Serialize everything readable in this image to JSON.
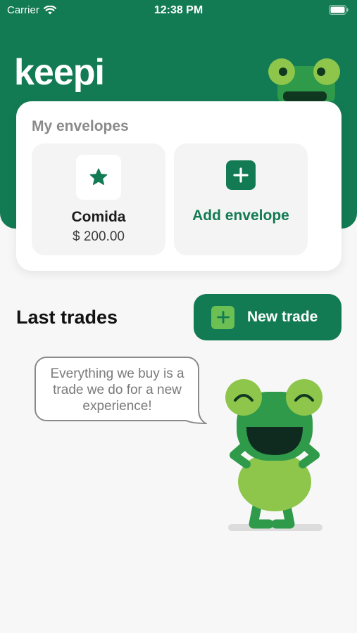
{
  "status_bar": {
    "carrier": "Carrier",
    "time": "12:38 PM"
  },
  "app": {
    "logo": "keepi",
    "brand_color": "#137b54",
    "accent_color": "#6cbf52"
  },
  "envelopes": {
    "title": "My envelopes",
    "items": [
      {
        "name": "Comida",
        "amount": "$ 200.00",
        "icon": "star-icon"
      }
    ],
    "add_label": "Add envelope"
  },
  "trades": {
    "title": "Last trades",
    "new_trade_label": "New trade",
    "empty_message": "Everything we buy is a trade we do for a new experience!"
  }
}
